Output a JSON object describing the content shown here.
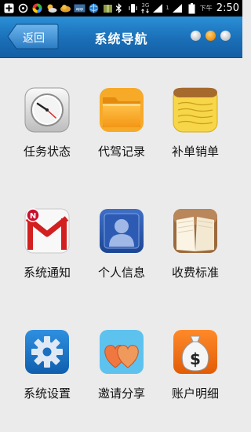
{
  "status_bar": {
    "network": "3G",
    "ampm": "下午",
    "time": "2:50",
    "signal_tag": "1"
  },
  "header": {
    "back_label": "返回",
    "title": "系统导航",
    "pages": 3,
    "active_page": 2
  },
  "grid": {
    "items": [
      {
        "label": "任务状态",
        "icon": "clock-icon"
      },
      {
        "label": "代驾记录",
        "icon": "folder-icon"
      },
      {
        "label": "补单销单",
        "icon": "notepad-icon"
      },
      {
        "label": "系统通知",
        "icon": "mail-icon"
      },
      {
        "label": "个人信息",
        "icon": "user-icon"
      },
      {
        "label": "收费标准",
        "icon": "book-icon"
      },
      {
        "label": "系统设置",
        "icon": "gear-icon"
      },
      {
        "label": "邀请分享",
        "icon": "hearts-icon"
      },
      {
        "label": "账户明细",
        "icon": "money-bag-icon"
      }
    ]
  },
  "colors": {
    "header": "#1a6fb8",
    "background": "#ebebeb",
    "active_dot": "#f39a1a"
  }
}
